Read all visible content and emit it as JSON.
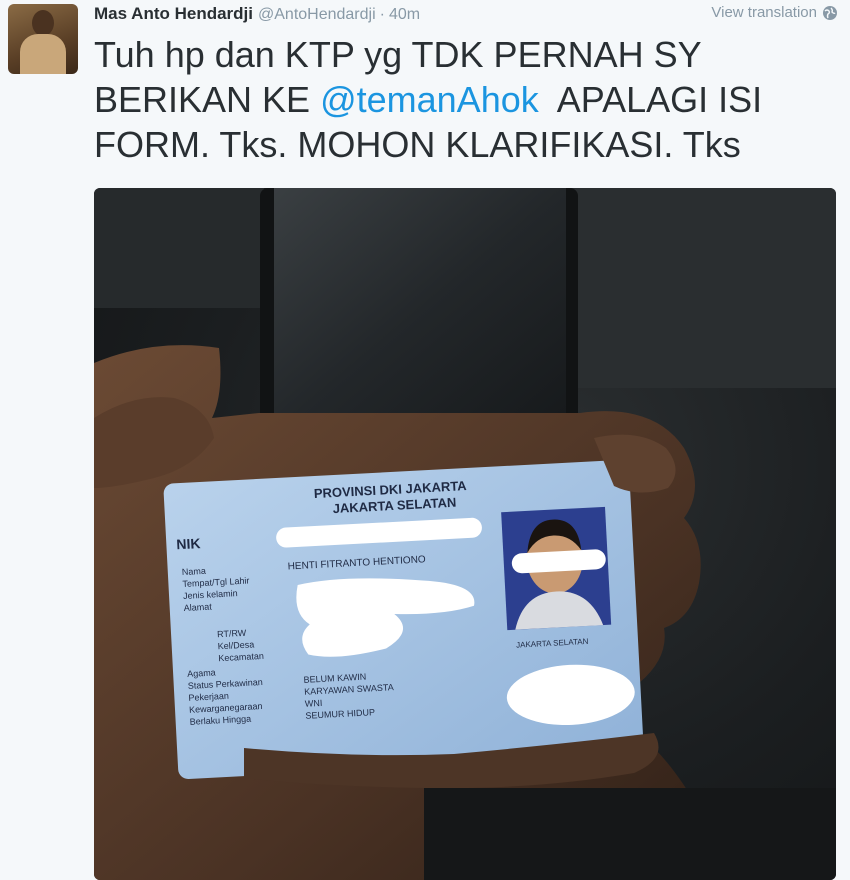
{
  "tweet": {
    "author": {
      "full_name": "Mas Anto Hendardji",
      "username": "@AntoHendardji",
      "separator": "·",
      "time": "40m"
    },
    "translate": {
      "label": "View translation",
      "icon": "globe-icon"
    },
    "text": {
      "line1": "Tuh hp dan KTP yg TDK PERNAH SY",
      "line2_before": "BERIKAN KE ",
      "mention": "@temanAhok",
      "line2_after": "  APALAGI ISI",
      "line3": "FORM. Tks. MOHON KLARIFIKASI. Tks"
    },
    "colors": {
      "mention": "#1b95e0",
      "text": "#292f33",
      "meta": "#8899a6",
      "background": "#f5f8fa"
    },
    "photo": {
      "id_card": {
        "province": "PROVINSI DKI JAKARTA",
        "city": "JAKARTA SELATAN",
        "nik_label": "NIK",
        "name_label": "Nama",
        "name_value": "HENTI FITRANTO HENTIONO",
        "birth_label": "Tempat/Tgl Lahir",
        "gender_label": "Jenis kelamin",
        "address_label": "Alamat",
        "rtrw_label": "RT/RW",
        "village_label": "Kel/Desa",
        "district_label": "Kecamatan",
        "religion_label": "Agama",
        "marital_label": "Status Perkawinan",
        "marital_value": "BELUM KAWIN",
        "job_label": "Pekerjaan",
        "job_value": "KARYAWAN SWASTA",
        "citizenship_label": "Kewarganegaraan",
        "citizenship_value": "WNI",
        "valid_label": "Berlaku Hingga",
        "valid_value": "SEUMUR HIDUP",
        "photo_city": "JAKARTA SELATAN"
      }
    }
  }
}
